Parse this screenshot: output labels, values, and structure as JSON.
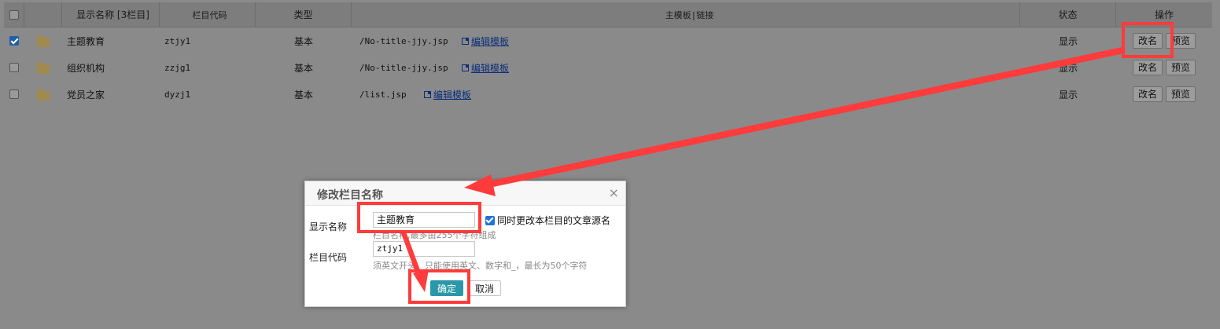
{
  "table": {
    "headers": {
      "name": "显示名称 [3栏目]",
      "code": "栏目代码",
      "type": "类型",
      "template": "主模板|链接",
      "status": "状态",
      "actions": "操作"
    },
    "rows": [
      {
        "checked": true,
        "name": "主题教育",
        "code": "ztjy1",
        "type": "基本",
        "template": "/No-title-jjy.jsp",
        "edit": "编辑模板",
        "status": "显示",
        "rename": "改名",
        "preview": "预览"
      },
      {
        "checked": false,
        "name": "组织机构",
        "code": "zzjg1",
        "type": "基本",
        "template": "/No-title-jjy.jsp",
        "edit": "编辑模板",
        "status": "显示",
        "rename": "改名",
        "preview": "预览"
      },
      {
        "checked": false,
        "name": "党员之家",
        "code": "dyzj1",
        "type": "基本",
        "template": "/list.jsp",
        "edit": "编辑模板",
        "status": "显示",
        "rename": "改名",
        "preview": "预览"
      }
    ]
  },
  "dialog": {
    "title": "修改栏目名称",
    "close": "×",
    "name_label": "显示名称",
    "name_value": "主题教育",
    "sync_label": "同时更改本栏目的文章源名",
    "name_hint": "栏目名称,最多由255个字符组成",
    "code_label": "栏目代码",
    "code_value": "ztjy1",
    "code_hint": "须英文开头，只能使用英文、数字和_，最长为50个字符",
    "ok": "确定",
    "cancel": "取消"
  },
  "colors": {
    "annotation": "#ff3b3b",
    "ok_button": "#2a98a8",
    "link": "#0b2d7a"
  }
}
